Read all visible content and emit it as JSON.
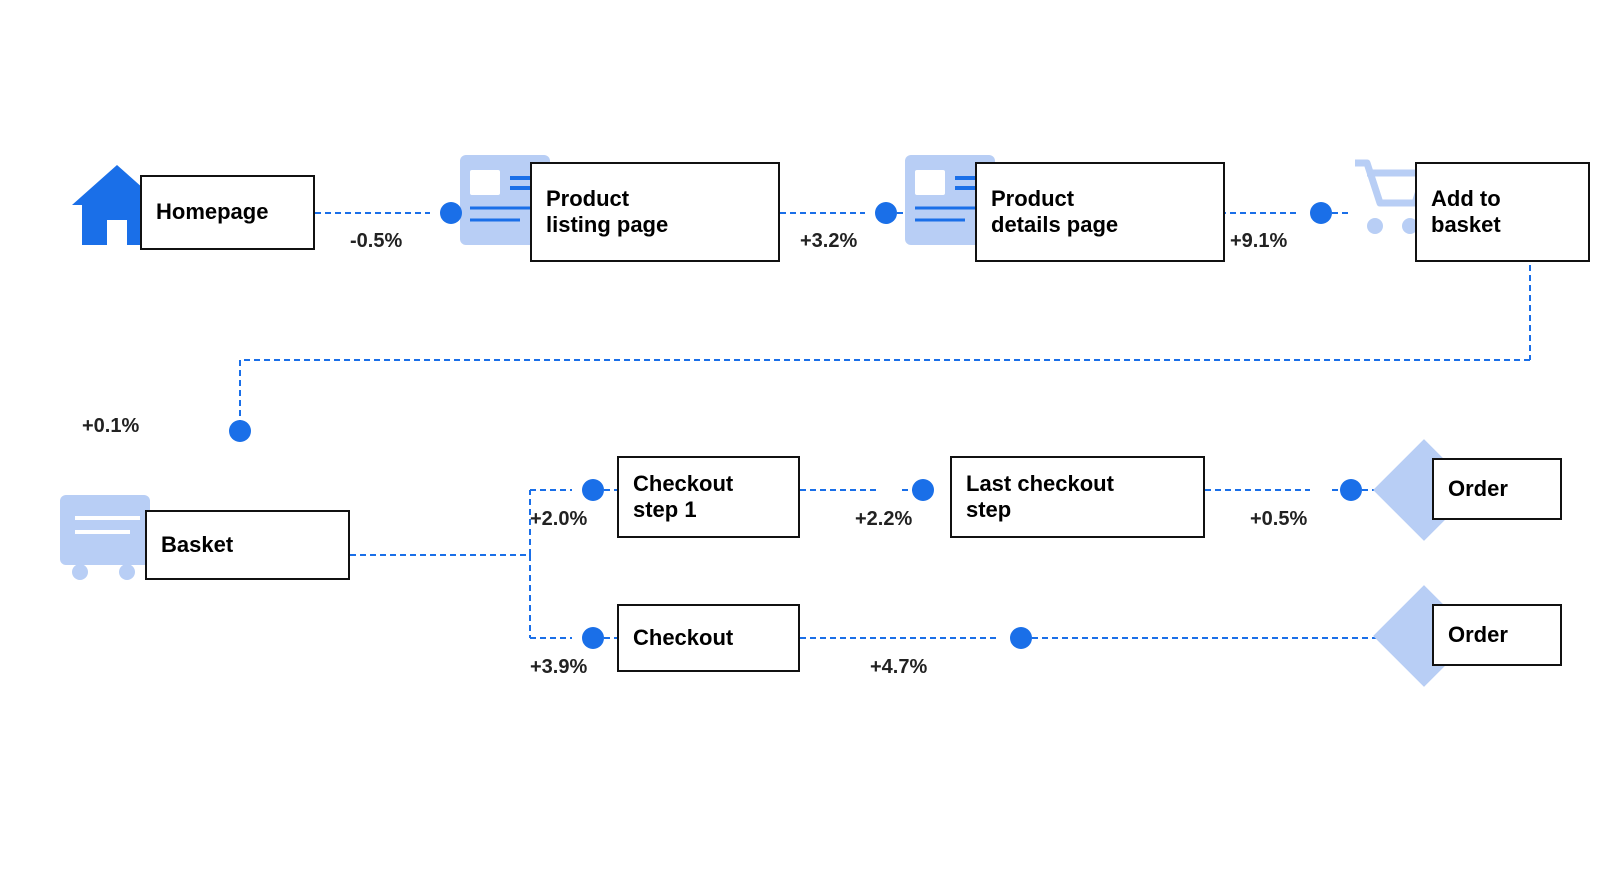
{
  "nodes": {
    "homepage": {
      "label": "Homepage"
    },
    "product_listing": {
      "label": "Product\nlisting page"
    },
    "product_details": {
      "label": "Product\ndetails page"
    },
    "add_to_basket": {
      "label": "Add to\nbasket"
    },
    "basket": {
      "label": "Basket"
    },
    "checkout_step1": {
      "label": "Checkout\nstep 1"
    },
    "last_checkout": {
      "label": "Last checkout\nstep"
    },
    "order1": {
      "label": "Order"
    },
    "checkout": {
      "label": "Checkout"
    },
    "order2": {
      "label": "Order"
    }
  },
  "percentages": {
    "hp_to_plp": "-0.5%",
    "plp_to_pdp": "+3.2%",
    "pdp_to_atb": "+9.1%",
    "basket_up": "+0.1%",
    "basket_to_cs1": "+2.0%",
    "cs1_to_lcs": "+2.2%",
    "lcs_to_order1": "+0.5%",
    "basket_to_checkout": "+3.9%",
    "checkout_to_order2": "+4.7%"
  },
  "colors": {
    "blue_icon": "#4a90d9",
    "blue_light": "#b8cef5",
    "dot_blue": "#1a6fe8",
    "line_color": "#1a6fe8"
  }
}
